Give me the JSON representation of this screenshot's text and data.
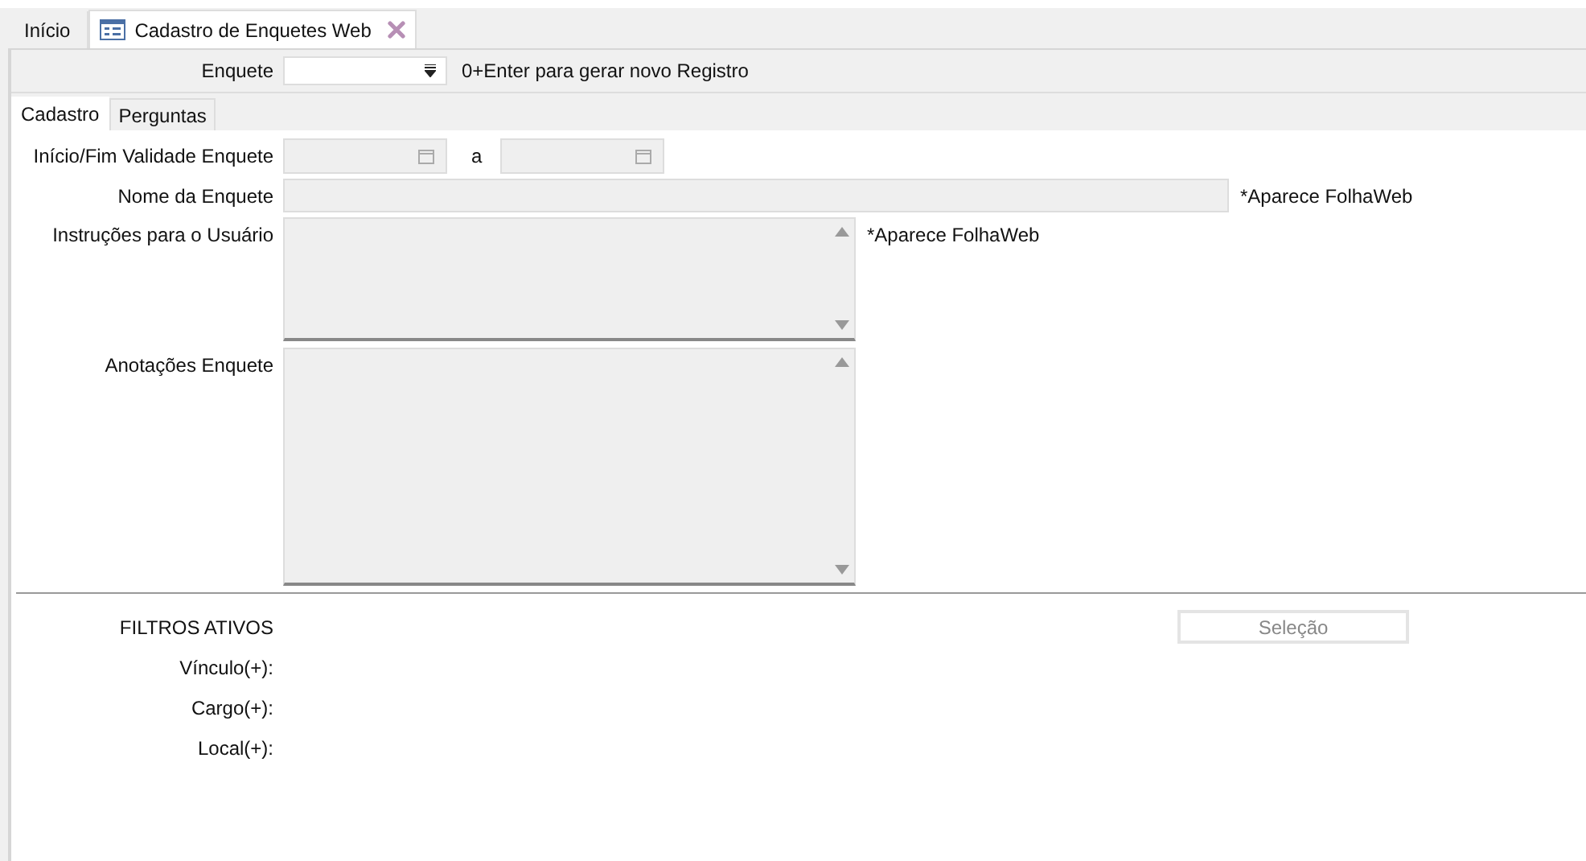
{
  "tabs": [
    {
      "label": "Início",
      "selected": false,
      "closable": false
    },
    {
      "label": "Cadastro de Enquetes Web",
      "selected": true,
      "closable": true
    }
  ],
  "enquete": {
    "label": "Enquete",
    "hint": "0+Enter para gerar novo Registro"
  },
  "subtabs": [
    {
      "label": "Cadastro",
      "selected": true
    },
    {
      "label": "Perguntas",
      "selected": false
    }
  ],
  "validade": {
    "label": "Início/Fim Validade Enquete",
    "separator": "a",
    "disabled": true
  },
  "nome": {
    "label": "Nome da Enquete",
    "note": "*Aparece FolhaWeb",
    "disabled": true
  },
  "instrucoes": {
    "label": "Instruções para o Usuário",
    "note": "*Aparece FolhaWeb",
    "disabled": true
  },
  "anotacoes": {
    "label": "Anotações Enquete",
    "disabled": true
  },
  "filtros": {
    "title": "FILTROS ATIVOS",
    "button": {
      "label": "Seleção",
      "disabled": true
    },
    "items": [
      "Vínculo(+):",
      "Cargo(+):",
      "Local(+):"
    ]
  }
}
